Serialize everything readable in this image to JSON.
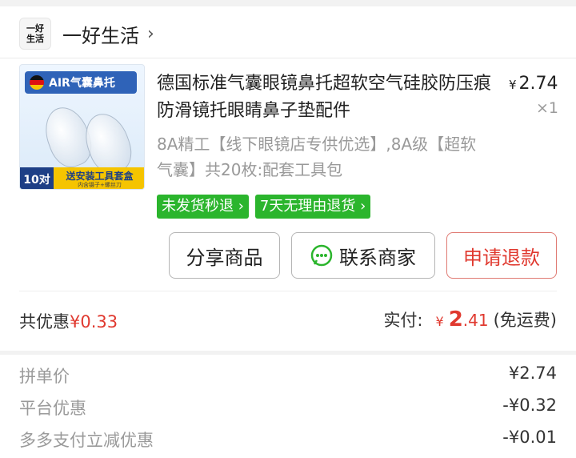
{
  "shop": {
    "logo_line1": "一好",
    "logo_line2": "生活",
    "name": "一好生活",
    "chevron": "›"
  },
  "product": {
    "image": {
      "banner": "AIR气囊鼻托",
      "count_badge": "10对",
      "gift_text": "送安装工具套盒",
      "gift_subtext": "内含镊子+螺丝刀"
    },
    "title": "德国标准气囊眼镜鼻托超软空气硅胶防压痕防滑镜托眼睛鼻子垫配件",
    "price_symbol": "¥",
    "price": "2.74",
    "quantity": "×1",
    "spec": "8A精工【线下眼镜店专供优选】,8A级【超软气囊】共20枚:配套工具包",
    "tags": [
      "未发货秒退 ›",
      "7天无理由退货 ›"
    ]
  },
  "actions": {
    "share": "分享商品",
    "contact": "联系商家",
    "refund": "申请退款"
  },
  "summary": {
    "discount_label": "共优惠",
    "discount_amount": "¥0.33",
    "paid_label": "实付:",
    "paid_symbol": "¥",
    "paid_integer": "2",
    "paid_fraction": ".41",
    "shipping_note": "(免运费)"
  },
  "details": [
    {
      "label": "拼单价",
      "value": "¥2.74"
    },
    {
      "label": "平台优惠",
      "value": "-¥0.32"
    },
    {
      "label": "多多支付立减优惠",
      "value": "-¥0.01"
    }
  ],
  "colors": {
    "accent_red": "#e0392f",
    "tag_green": "#2bb52d"
  }
}
